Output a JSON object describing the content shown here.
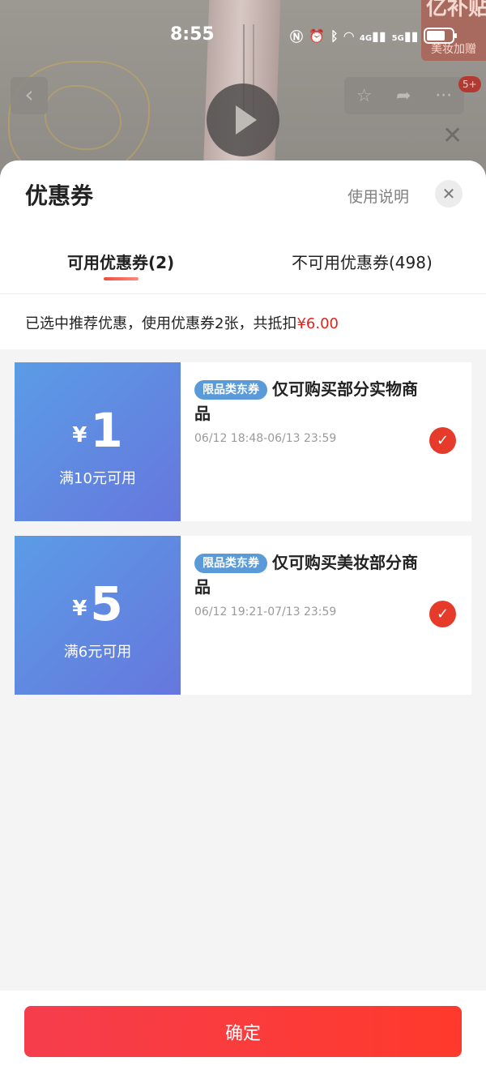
{
  "status_bar": {
    "time": "8:55",
    "icons": [
      "nfc-icon",
      "alarm-icon",
      "bluetooth-icon",
      "wifi-icon",
      "4g-signal-icon",
      "5g-signal-icon",
      "battery-icon"
    ],
    "net_4g": "4G",
    "net_5g": "5G"
  },
  "background": {
    "promo_text": "亿补贴",
    "promo_sub": "美妆加赠",
    "badge": "5+"
  },
  "sheet": {
    "title": "优惠券",
    "usage_link": "使用说明",
    "close_icon": "close-icon"
  },
  "tabs": [
    {
      "label": "可用优惠券(2)",
      "active": true
    },
    {
      "label": "不可用优惠券(498)",
      "active": false
    }
  ],
  "summary": {
    "prefix": "已选中推荐优惠，使用优惠券2张，共抵扣",
    "amount": "¥6.00"
  },
  "coupons": [
    {
      "currency": "¥",
      "value": "1",
      "condition": "满10元可用",
      "tag": "限品类东券",
      "description": "仅可购买部分实物商品",
      "validity": "06/12 18:48-06/13 23:59",
      "selected": true
    },
    {
      "currency": "¥",
      "value": "5",
      "condition": "满6元可用",
      "tag": "限品类东券",
      "description": "仅可购买美妆部分商品",
      "validity": "06/12 19:21-07/13 23:59",
      "selected": true
    }
  ],
  "footer": {
    "confirm_label": "确定"
  },
  "colors": {
    "accent_red": "#e2231a",
    "coupon_blue_start": "#5b9ce6",
    "coupon_blue_end": "#6677dd",
    "tag_blue": "#5a9ad8"
  }
}
